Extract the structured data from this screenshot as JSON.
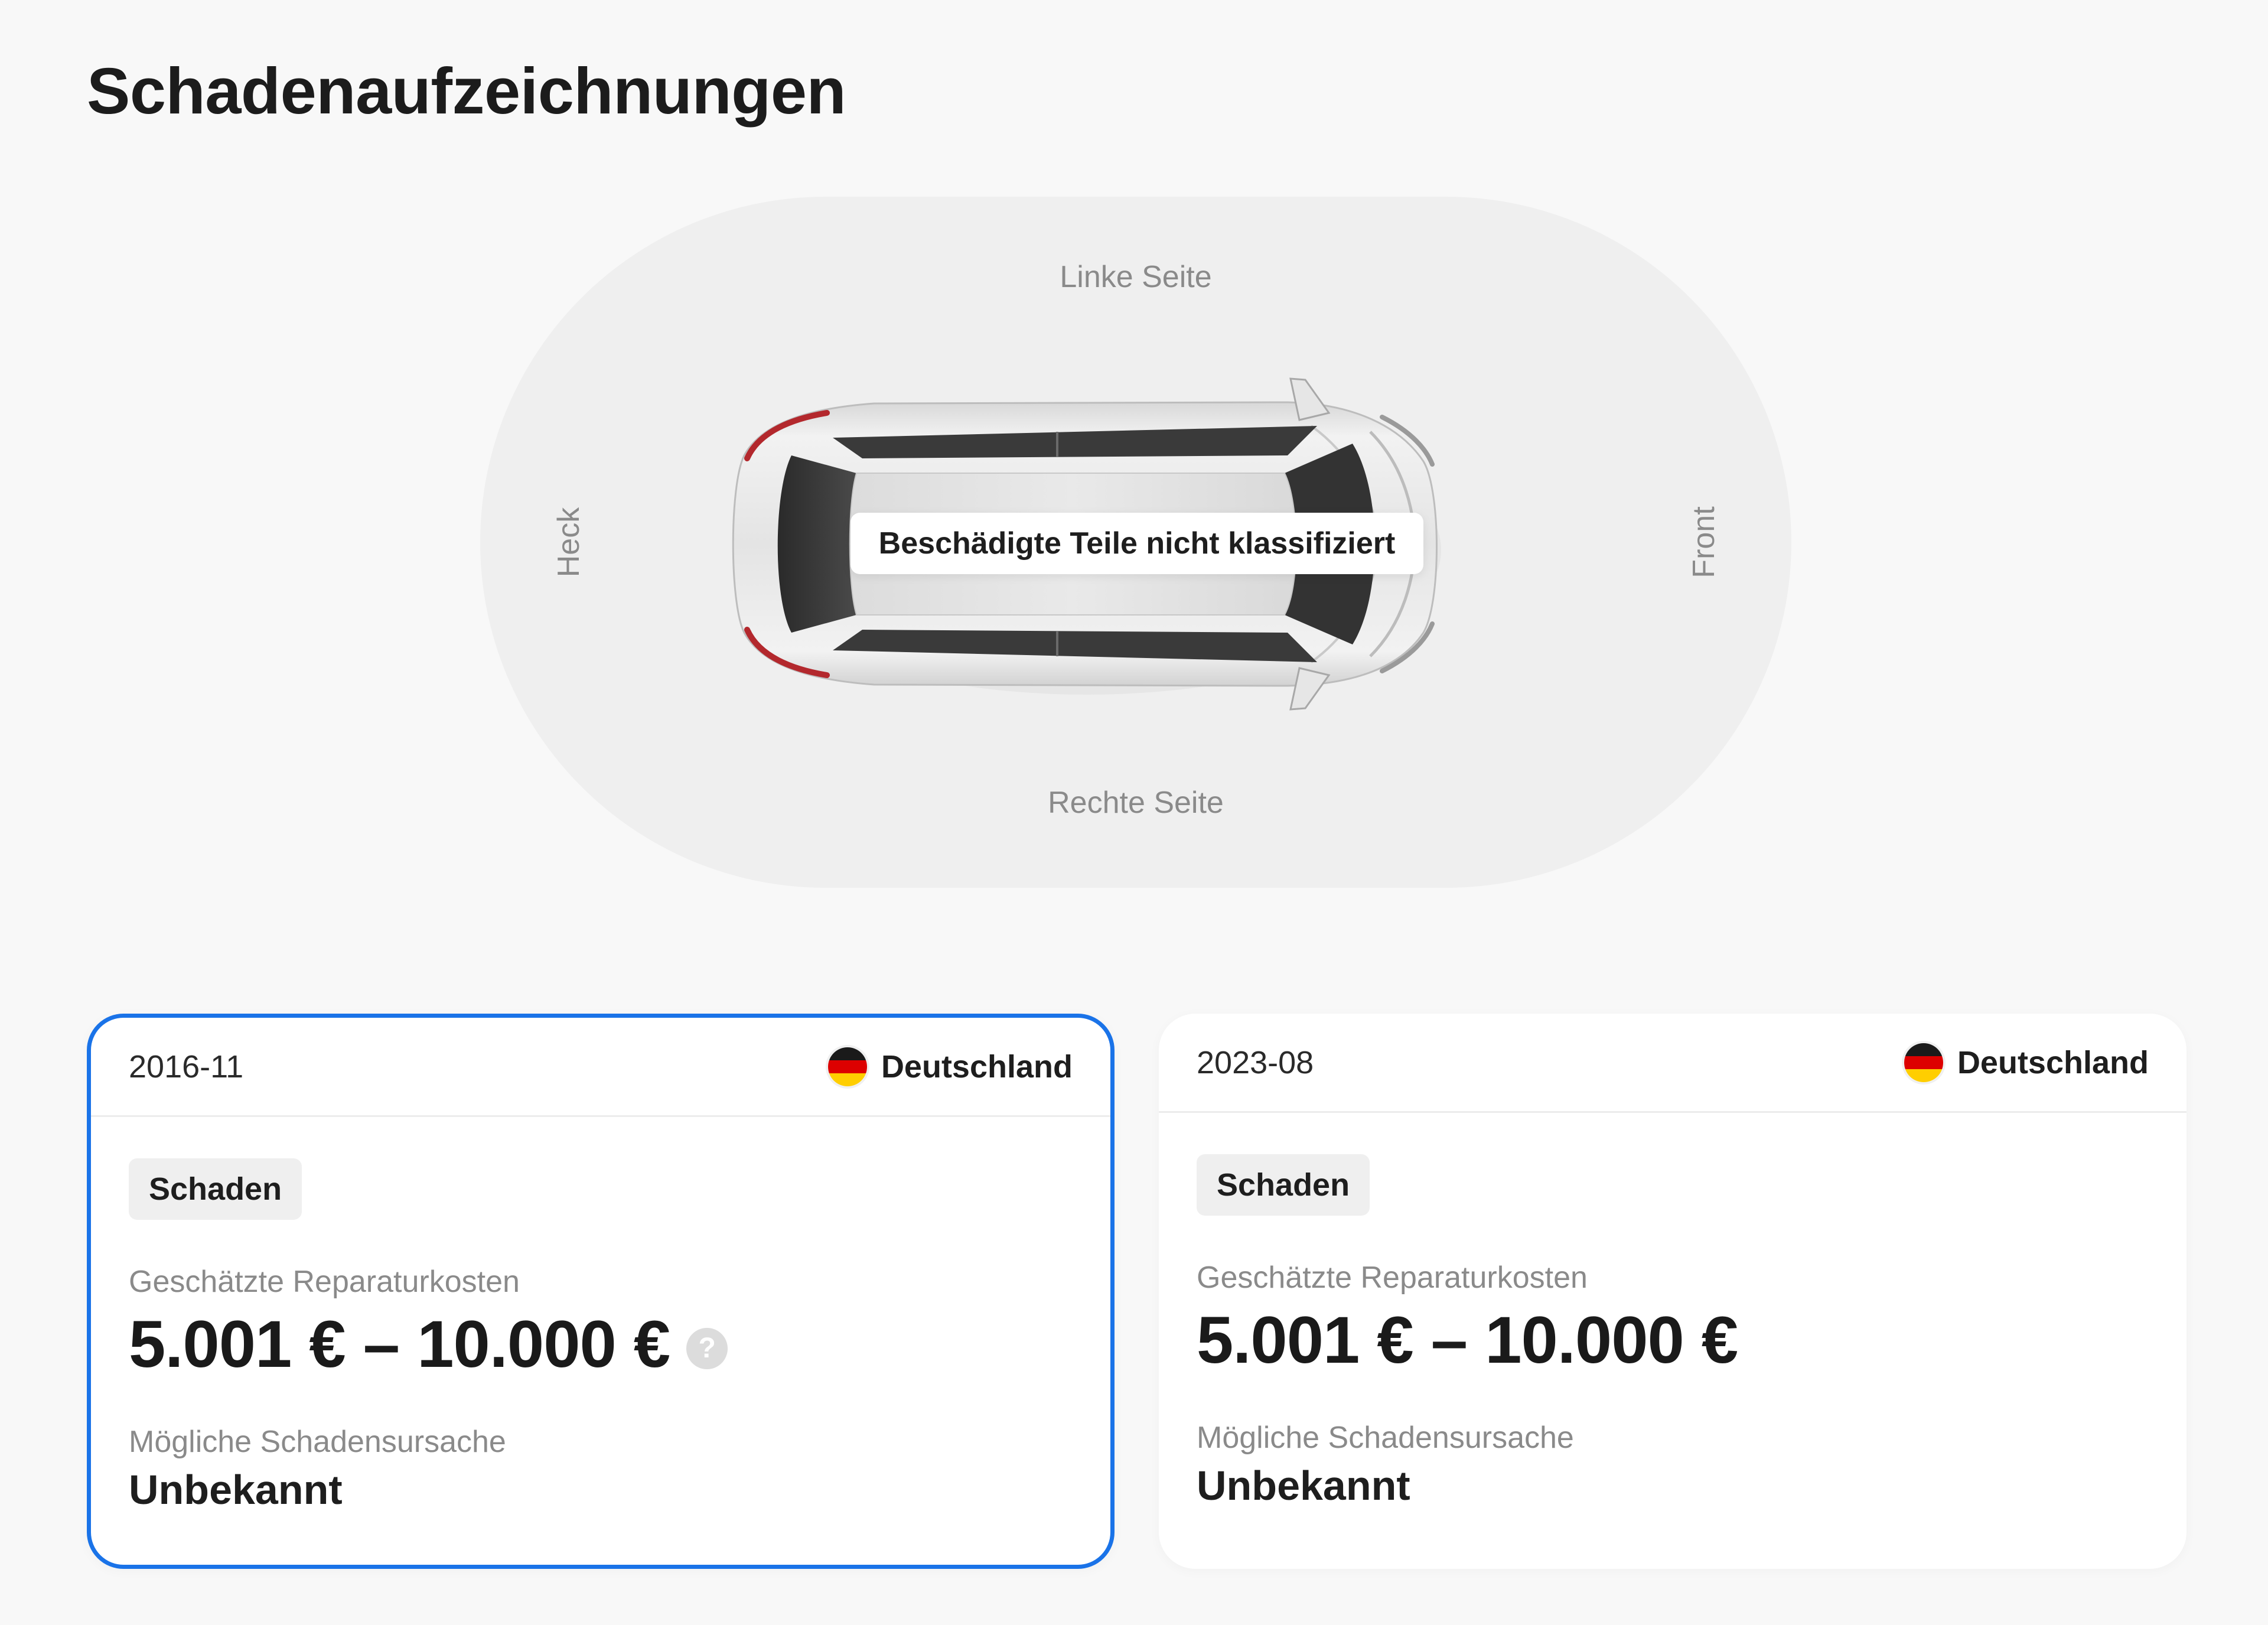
{
  "page": {
    "title": "Schadenaufzeichnungen"
  },
  "diagram": {
    "labels": {
      "left_side": "Linke Seite",
      "right_side": "Rechte Seite",
      "rear": "Heck",
      "front": "Front"
    },
    "tooltip": "Beschädigte Teile nicht klassifiziert"
  },
  "records": [
    {
      "date": "2016-11",
      "country": "Deutschland",
      "type": "Schaden",
      "cost_label": "Geschätzte Reparaturkosten",
      "cost": "5.001 € – 10.000 €",
      "help_icon": "?",
      "cause_label": "Mögliche Schadensursache",
      "cause": "Unbekannt",
      "selected": true
    },
    {
      "date": "2023-08",
      "country": "Deutschland",
      "type": "Schaden",
      "cost_label": "Geschätzte Reparaturkosten",
      "cost": "5.001 € – 10.000 €",
      "cause_label": "Mögliche Schadensursache",
      "cause": "Unbekannt",
      "selected": false
    }
  ],
  "colors": {
    "selected_border": "#1a73e8",
    "background": "#f8f8f8",
    "diagram_background": "#efefef"
  },
  "icons": {
    "flag": "germany-flag-icon",
    "help": "question-circle-icon",
    "car": "car-top-view-icon"
  }
}
